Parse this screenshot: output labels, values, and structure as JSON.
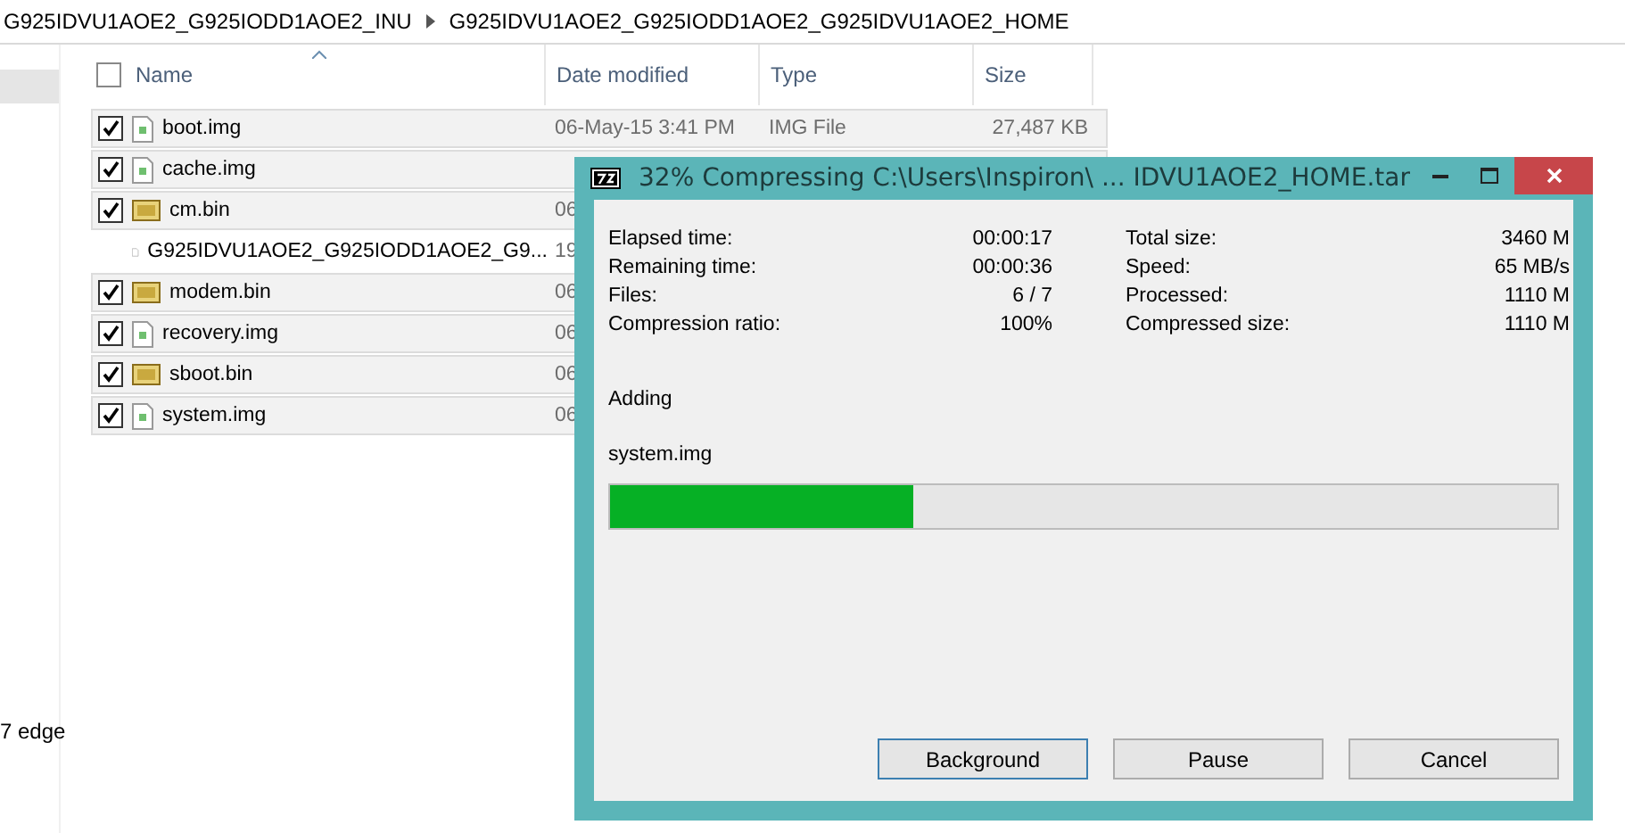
{
  "breadcrumb": [
    "G925IDVU1AOE2_G925IODD1AOE2_INU",
    "G925IDVU1AOE2_G925IODD1AOE2_G925IDVU1AOE2_HOME"
  ],
  "sidebar": {
    "items": [
      {
        "selected": true
      },
      {
        "label": "7 edge",
        "selected": false
      }
    ]
  },
  "select_all_checked": false,
  "columns": [
    "Name",
    "Date modified",
    "Type",
    "Size"
  ],
  "files": [
    {
      "name": "boot.img",
      "kind": "image",
      "checked": true,
      "date": "06-May-15 3:41 PM",
      "type": "IMG File",
      "size": "27,487 KB"
    },
    {
      "name": "cache.img",
      "kind": "image",
      "checked": true
    },
    {
      "name": "cm.bin",
      "kind": "iso",
      "checked": true,
      "date": "06"
    },
    {
      "name": "G925IDVU1AOE2_G925IODD1AOE2_G9...",
      "kind": "blank",
      "checked": false,
      "date": "19"
    },
    {
      "name": "modem.bin",
      "kind": "iso",
      "checked": true,
      "date": "06"
    },
    {
      "name": "recovery.img",
      "kind": "image",
      "checked": true,
      "date": "06"
    },
    {
      "name": "sboot.bin",
      "kind": "iso",
      "checked": true,
      "date": "06"
    },
    {
      "name": "system.img",
      "kind": "image",
      "checked": true,
      "date": "06"
    }
  ],
  "dialog": {
    "title": "32% Compressing C:\\Users\\Inspiron\\ ... IDVU1AOE2_HOME.tar",
    "stats_left": [
      {
        "label": "Elapsed time:",
        "value": "00:00:17"
      },
      {
        "label": "Remaining time:",
        "value": "00:00:36"
      },
      {
        "label": "Files:",
        "value": "6 / 7"
      },
      {
        "label": "Compression ratio:",
        "value": "100%"
      }
    ],
    "stats_right": [
      {
        "label": "Total size:",
        "value": "3460 M"
      },
      {
        "label": "Speed:",
        "value": "65 MB/s"
      },
      {
        "label": "Processed:",
        "value": "1110 M"
      },
      {
        "label": "Compressed size:",
        "value": "1110 M"
      }
    ],
    "action": "Adding",
    "current_file": "system.img",
    "progress": {
      "level": 0.32
    },
    "buttons": [
      {
        "label": "Background",
        "selected": true
      },
      {
        "label": "Pause",
        "selected": false
      },
      {
        "label": "Cancel",
        "selected": false
      }
    ]
  }
}
